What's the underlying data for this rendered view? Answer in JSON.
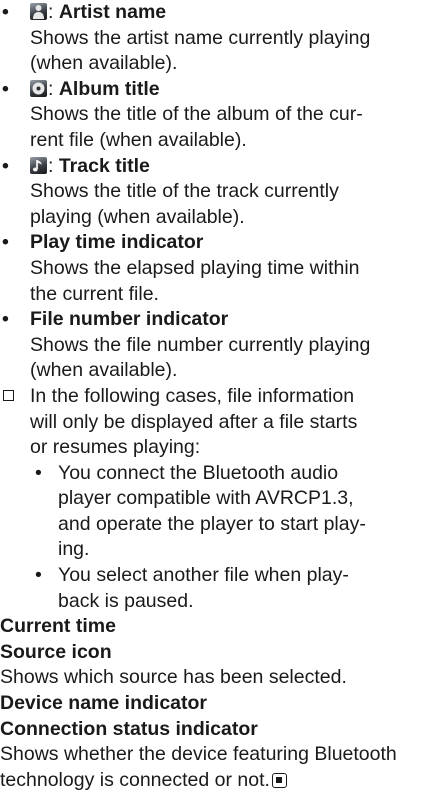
{
  "items": [
    {
      "label": "Artist name",
      "icon": "artist-icon",
      "desc": [
        "Shows the artist name currently playing",
        "(when available)."
      ]
    },
    {
      "label": "Album title",
      "icon": "album-icon",
      "desc": [
        "Shows the title of the album of the cur-",
        "rent file (when available)."
      ]
    },
    {
      "label": "Track title",
      "icon": "track-icon",
      "desc": [
        "Shows the title of the track currently",
        "playing (when available)."
      ]
    },
    {
      "label": "Play time indicator",
      "desc": [
        "Shows the elapsed playing time within",
        "the current file."
      ]
    },
    {
      "label": "File number indicator",
      "desc": [
        "Shows the file number currently playing",
        "(when available)."
      ]
    }
  ],
  "note": {
    "lines": [
      "In the following cases, file information",
      "will only be displayed after a file starts",
      "or resumes playing:"
    ],
    "subitems": [
      {
        "lines": [
          "You connect the Bluetooth audio",
          "player compatible with AVRCP1.3,",
          "and operate the player to start play-",
          "ing."
        ]
      },
      {
        "lines": [
          "You select another file when play-",
          "back is paused."
        ]
      }
    ]
  },
  "sections": {
    "current_time": "Current time",
    "source_icon": "Source icon",
    "source_icon_desc": "Shows which source has been selected.",
    "device_name": "Device name indicator",
    "connection_status": "Connection status indicator",
    "connection_desc": [
      "Shows whether the device featuring Bluetooth",
      "technology is connected or not."
    ]
  },
  "bullet": "•",
  "colon": ":"
}
